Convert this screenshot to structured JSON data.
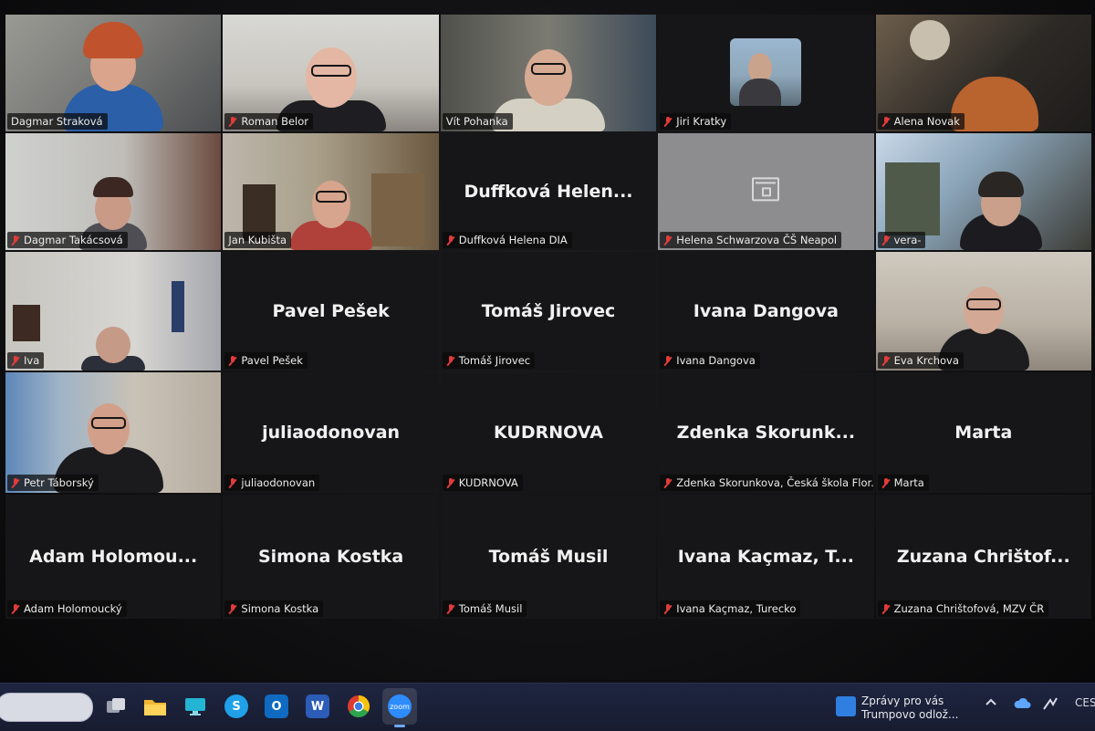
{
  "window": {
    "app_name": "Zoom",
    "accent_active_speaker": "#3fd08a",
    "muted_color": "#e23b3b"
  },
  "participants": [
    {
      "label": "Dagmar Straková",
      "muted": false,
      "display": "",
      "type": "video"
    },
    {
      "label": "Roman Belor",
      "muted": true,
      "display": "",
      "type": "video"
    },
    {
      "label": "Vít Pohanka",
      "muted": false,
      "display": "",
      "type": "video"
    },
    {
      "label": "Jiri Kratky",
      "muted": true,
      "display": "",
      "type": "photo"
    },
    {
      "label": "Alena Novak",
      "muted": true,
      "display": "",
      "type": "video"
    },
    {
      "label": "Dagmar Takácsová",
      "muted": true,
      "display": "",
      "type": "video"
    },
    {
      "label": "Jan Kubišta",
      "muted": false,
      "display": "",
      "type": "video",
      "active_speaker": true
    },
    {
      "label": "Duffková Helena DIA",
      "muted": true,
      "display": "Duffková  Helen...",
      "type": "name"
    },
    {
      "label": "Helena Schwarzova ČŠ Neapol",
      "muted": true,
      "display": "",
      "type": "locked"
    },
    {
      "label": "vera-",
      "muted": true,
      "display": "",
      "type": "video"
    },
    {
      "label": "Iva",
      "muted": true,
      "display": "",
      "type": "video"
    },
    {
      "label": "Pavel Pešek",
      "muted": true,
      "display": "Pavel Pešek",
      "type": "name"
    },
    {
      "label": "Tomáš Jirovec",
      "muted": true,
      "display": "Tomáš Jirovec",
      "type": "name"
    },
    {
      "label": "Ivana Dangova",
      "muted": true,
      "display": "Ivana Dangova",
      "type": "name"
    },
    {
      "label": "Eva Krchova",
      "muted": true,
      "display": "",
      "type": "video"
    },
    {
      "label": "Petr Táborský",
      "muted": true,
      "display": "",
      "type": "video"
    },
    {
      "label": "juliaodonovan",
      "muted": true,
      "display": "juliaodonovan",
      "type": "name"
    },
    {
      "label": "KUDRNOVA",
      "muted": true,
      "display": "KUDRNOVA",
      "type": "name"
    },
    {
      "label": "Zdenka Skorunkova, Česká škola Flor...",
      "muted": true,
      "display": "Zdenka  Skorunk...",
      "type": "name"
    },
    {
      "label": "Marta",
      "muted": true,
      "display": "Marta",
      "type": "name"
    },
    {
      "label": "Adam Holomoucký",
      "muted": true,
      "display": "Adam  Holomou...",
      "type": "name"
    },
    {
      "label": "Simona Kostka",
      "muted": true,
      "display": "Simona Kostka",
      "type": "name"
    },
    {
      "label": "Tomáš Musil",
      "muted": true,
      "display": "Tomáš Musil",
      "type": "name"
    },
    {
      "label": "Ivana Kaçmaz, Turecko",
      "muted": true,
      "display": "Ivana  Kaçmaz,  T...",
      "type": "name"
    },
    {
      "label": "Zuzana Chrištofová, MZV ČR",
      "muted": true,
      "display": "Zuzana  Chrištof...",
      "type": "name"
    }
  ],
  "taskbar": {
    "apps": [
      {
        "name": "task-view-icon"
      },
      {
        "name": "file-explorer-icon"
      },
      {
        "name": "monitor-icon"
      },
      {
        "name": "skype-icon",
        "glyph": "S"
      },
      {
        "name": "outlook-icon",
        "glyph": "O"
      },
      {
        "name": "word-icon",
        "glyph": "W"
      },
      {
        "name": "chrome-icon"
      },
      {
        "name": "zoom-icon",
        "glyph": "zoom"
      }
    ],
    "news_line1": "Zprávy pro vás",
    "news_line2": "Trumpovo odlož...",
    "tray_language": "CES"
  }
}
